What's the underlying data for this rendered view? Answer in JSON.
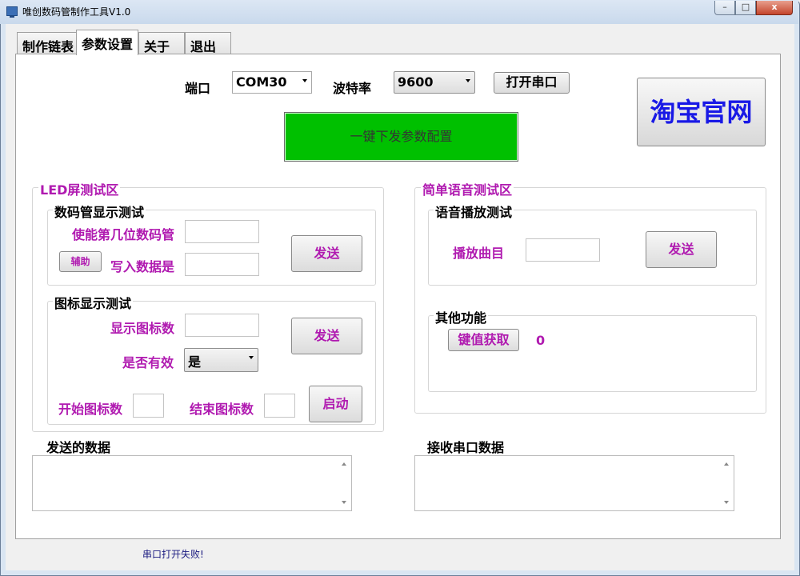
{
  "window": {
    "title": "唯创数码管制作工具V1.0",
    "controls": {
      "minimize": "–",
      "maximize": "□",
      "close": "x"
    }
  },
  "tabs": [
    {
      "label": "制作链表",
      "active": false
    },
    {
      "label": "参数设置",
      "active": true
    },
    {
      "label": "关于",
      "active": false
    },
    {
      "label": "退出",
      "active": false
    }
  ],
  "port": {
    "port_label": "端口",
    "port_value": "COM30",
    "baud_label": "波特率",
    "baud_value": "9600",
    "open_button": "打开串口"
  },
  "config_button": "一键下发参数配置",
  "taobao_button": "淘宝官网",
  "led_area": {
    "title": "LED屏测试区",
    "digit_group": {
      "title": "数码管显示测试",
      "enable_label": "使能第几位数码管",
      "write_label": "写入数据是",
      "aux_button": "辅助",
      "send_button": "发送",
      "enable_value": "",
      "write_value": ""
    },
    "icon_group": {
      "title": "图标显示测试",
      "count_label": "显示图标数",
      "valid_label": "是否有效",
      "valid_value": "是",
      "send_button": "发送",
      "start_label": "开始图标数",
      "end_label": "结束图标数",
      "start_button": "启动",
      "count_value": "",
      "start_value": "",
      "end_value": ""
    }
  },
  "voice_area": {
    "title": "简单语音测试区",
    "play_group": {
      "title": "语音播放测试",
      "track_label": "播放曲目",
      "track_value": "",
      "send_button": "发送"
    },
    "other_group": {
      "title": "其他功能",
      "key_button": "键值获取",
      "key_value": "0"
    }
  },
  "sent_data": {
    "label": "发送的数据",
    "value": ""
  },
  "received_data": {
    "label": "接收串口数据",
    "value": ""
  },
  "status_text": "串口打开失败!",
  "colors": {
    "accent_label": "#b01ab0",
    "config_button": "#00c000",
    "taobao_text": "#1919e6"
  }
}
